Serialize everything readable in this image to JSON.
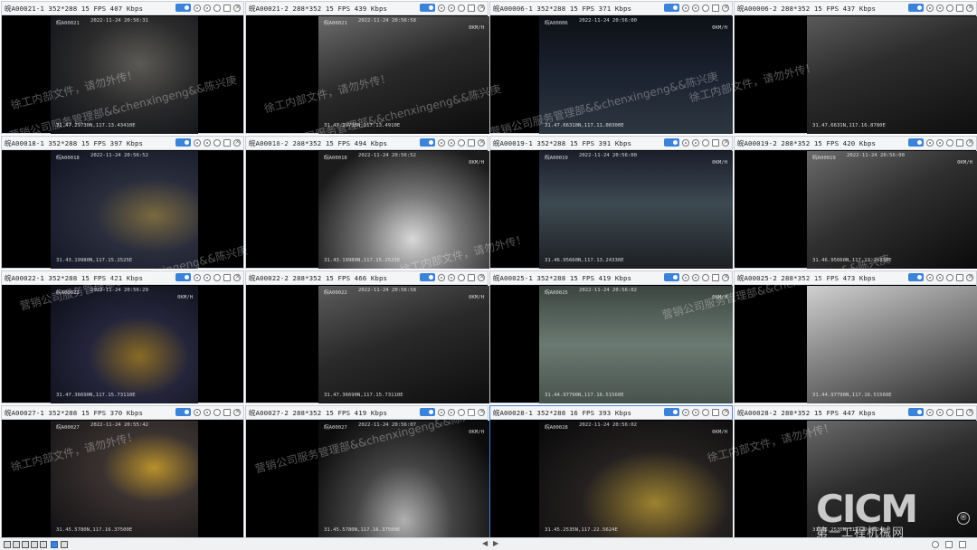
{
  "tiles": [
    {
      "title": "皖A00021-1 352*288 15 FPS 407 Kbps",
      "osd": {
        "cam": "皖A00021",
        "time": "2022-11-24  20:56:31",
        "speed": "",
        "gps": "31.47.29730N,117.13.43410E"
      }
    },
    {
      "title": "皖A00021-2 288*352 15 FPS 439 Kbps",
      "osd": {
        "cam": "皖A00021",
        "time": "2022-11-24  20:56:58",
        "speed": "0KM/H",
        "gps": "31.47.29730N,117.13.4910E"
      }
    },
    {
      "title": "皖A00006-1 352*288 15 FPS 371 Kbps",
      "osd": {
        "cam": "皖A00006",
        "time": "2022-11-24  20:56:00",
        "speed": "0KM/H",
        "gps": "31.47.66310N,117.11.08300E"
      }
    },
    {
      "title": "皖A00006-2 288*352 15 FPS 437 Kbps",
      "osd": {
        "cam": "",
        "time": "",
        "speed": "",
        "gps": "31.47.6631N,117.16.8780E"
      }
    },
    {
      "title": "皖A00018-1 352*288 15 FPS 397 Kbps",
      "osd": {
        "cam": "皖A00018",
        "time": "2022-11-24  20:56:52",
        "speed": "",
        "gps": "31.43.19980N,117.15.2525E"
      }
    },
    {
      "title": "皖A00018-2 288*352 15 FPS 494 Kbps",
      "osd": {
        "cam": "皖A00018",
        "time": "2022-11-24  20:56:52",
        "speed": "0KM/H",
        "gps": "31.43.19980N,117.15.2525E"
      }
    },
    {
      "title": "皖A00019-1 352*288 15 FPS 391 Kbps",
      "osd": {
        "cam": "皖A00019",
        "time": "2022-11-24  20:56:00",
        "speed": "0KM/H",
        "gps": "31.46.95660N,117.13.24330E"
      }
    },
    {
      "title": "皖A00019-2 288*352 15 FPS 420 Kbps",
      "osd": {
        "cam": "皖A00019",
        "time": "2022-11-24  20:56:00",
        "speed": "0KM/H",
        "gps": "31.46.95660N,117.13.24330E"
      }
    },
    {
      "title": "皖A00022-1 352*288 15 FPS 421 Kbps",
      "osd": {
        "cam": "皖A00022",
        "time": "2022-11-24  20:56:29",
        "speed": "0KM/H",
        "gps": "31.47.36690N,117.15.73110E"
      }
    },
    {
      "title": "皖A00022-2 288*352 15 FPS 466 Kbps",
      "osd": {
        "cam": "皖A00022",
        "time": "2022-11-24  20:56:58",
        "speed": "0KM/H",
        "gps": "31.47.36690N,117.15.73110E"
      }
    },
    {
      "title": "皖A00025-1 352*288 15 FPS 419 Kbps",
      "osd": {
        "cam": "皖A00025",
        "time": "2022-11-24  20:56:02",
        "speed": "0KM/H",
        "gps": "31.44.97790N,117.16.51560E"
      }
    },
    {
      "title": "皖A00025-2 288*352 15 FPS 473 Kbps",
      "osd": {
        "cam": "",
        "time": "",
        "speed": "",
        "gps": "31.44.97790N,117.16.51560E"
      }
    },
    {
      "title": "皖A00027-1 352*288 15 FPS 370 Kbps",
      "osd": {
        "cam": "皖A00027",
        "time": "2022-11-24  20:55:42",
        "speed": "",
        "gps": "31.45.5780N,117.16.37500E"
      }
    },
    {
      "title": "皖A00027-2 288*352 15 FPS 419 Kbps",
      "osd": {
        "cam": "皖A00027",
        "time": "2022-11-24  20:56:07",
        "speed": "0KM/H",
        "gps": "31.45.5780N,117.16.37500E"
      }
    },
    {
      "title": "皖A00028-1 352*288 16 FPS 393 Kbps",
      "osd": {
        "cam": "皖A00028",
        "time": "2022-11-24  20:56:02",
        "speed": "0KM/H",
        "gps": "31.45.2535N,117.22.5624E"
      }
    },
    {
      "title": "皖A00028-2 288*352 15 FPS 447 Kbps",
      "osd": {
        "cam": "",
        "time": "",
        "speed": "",
        "gps": "31.45.2535N,117.22.5624E"
      }
    }
  ],
  "watermarks": [
    {
      "text": "徐工内部文件，请勿外传！"
    },
    {
      "text": "营销公司服务管理部&&chenxingeng&&陈兴庚"
    },
    {
      "text": "徐工内部文件，请勿外传！"
    },
    {
      "text": "营销公司服务管理部&&chenxingeng&&陈兴庚"
    },
    {
      "text": "营销公司服务管理部&&chenxingeng&&陈兴庚"
    },
    {
      "text": "徐工内部文件，请勿外传！"
    },
    {
      "text": "营销公司服务管理部&&chenxingeng&&陈兴庚"
    },
    {
      "text": "徐工内部文件，请勿外传！"
    },
    {
      "text": "营销公司服务管理部&&chenxingeng&&陈兴庚"
    },
    {
      "text": "徐工内部文件，请勿外传！"
    },
    {
      "text": "营销公司服务管理部&&chenxingeng&&陈兴庚"
    },
    {
      "text": "徐工内部文件，请勿外传！"
    }
  ],
  "brand": {
    "logo": "CICM",
    "sub": "第一工程机械网",
    "reg": "®"
  },
  "statusbar": {
    "layout_active_index": 6,
    "prev_arrow": "◀",
    "next_arrow": "▶"
  },
  "colors": {
    "accent": "#3b82d9",
    "header_bg": "#f4f5f7",
    "selected_border": "#4a7fd6"
  }
}
